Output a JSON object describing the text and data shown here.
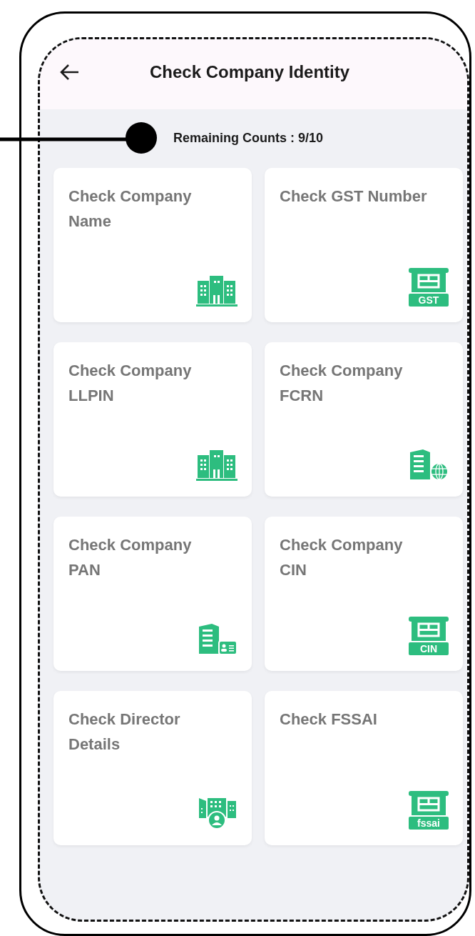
{
  "header": {
    "title": "Check Company Identity"
  },
  "remaining": "Remaining Counts : 9/10",
  "cards": [
    {
      "title": "Check Company Name",
      "kind": "buildings"
    },
    {
      "title": "Check GST Number",
      "kind": "counter",
      "badge": "GST"
    },
    {
      "title": "Check Company LLPIN",
      "kind": "buildings"
    },
    {
      "title": "Check Company FCRN",
      "kind": "globe"
    },
    {
      "title": "Check Company PAN",
      "kind": "idcard"
    },
    {
      "title": "Check Company CIN",
      "kind": "counter",
      "badge": "CIN"
    },
    {
      "title": "Check Director Details",
      "kind": "person"
    },
    {
      "title": "Check FSSAI",
      "kind": "counter",
      "badge": "fssai"
    }
  ]
}
